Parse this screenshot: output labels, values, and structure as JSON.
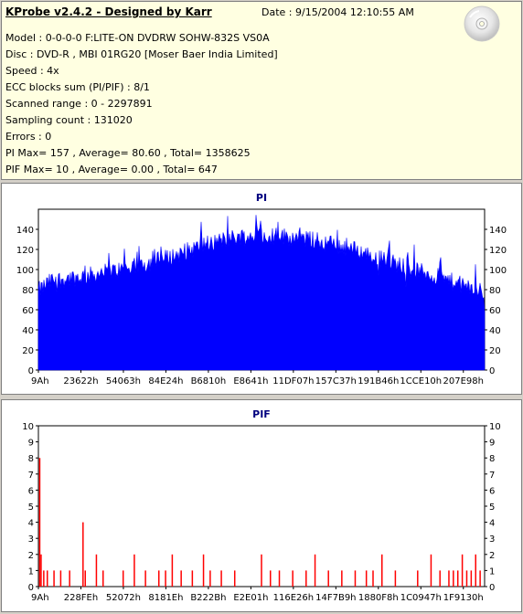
{
  "header": {
    "app_title": "KProbe v2.4.2 - Designed by Karr",
    "date": "Date : 9/15/2004 12:10:55 AM",
    "lines": [
      "Model : 0-0-0-0 F:LITE-ON DVDRW SOHW-832S  VS0A",
      "Disc : DVD-R , MBI 01RG20   [Moser Baer India Limited]",
      "Speed : 4x",
      "ECC blocks sum (PI/PIF) : 8/1",
      "Scanned range : 0 - 2297891",
      "Sampling count : 131020",
      "Errors : 0",
      "PI Max= 157 , Average= 80.60 , Total= 1358625",
      "PIF Max= 10 , Average= 0.00 , Total= 647"
    ],
    "icon": "disc-icon"
  },
  "chart_data": [
    {
      "type": "area",
      "title": "PI",
      "color": "#0000ff",
      "ylim": [
        0,
        160
      ],
      "yticks": [
        0,
        20,
        40,
        60,
        80,
        100,
        120,
        140
      ],
      "xtick_labels": [
        "9Ah",
        "23622h",
        "54063h",
        "84E24h",
        "B6810h",
        "E8641h",
        "11DF07h",
        "157C37h",
        "191B46h",
        "1CCE10h",
        "207E98h"
      ],
      "profile": {
        "x": [
          0,
          0.03,
          0.1,
          0.2,
          0.3,
          0.38,
          0.45,
          0.5,
          0.55,
          0.62,
          0.7,
          0.78,
          0.85,
          0.92,
          0.97,
          1.0
        ],
        "y": [
          78,
          88,
          92,
          100,
          112,
          125,
          132,
          133,
          132,
          128,
          120,
          108,
          98,
          88,
          80,
          76
        ]
      },
      "grid": false
    },
    {
      "type": "bar",
      "title": "PIF",
      "color": "#ff0000",
      "ylim": [
        0,
        10
      ],
      "yticks": [
        0,
        1,
        2,
        3,
        4,
        5,
        6,
        7,
        8,
        9,
        10
      ],
      "xtick_labels": [
        "9Ah",
        "228FEh",
        "52072h",
        "8181Eh",
        "B222Bh",
        "E2E01h",
        "116E26h",
        "14F7B9h",
        "1880F8h",
        "1C0947h",
        "1F9130h"
      ],
      "spikes": [
        {
          "x": 0.003,
          "y": 8
        },
        {
          "x": 0.006,
          "y": 2
        },
        {
          "x": 0.012,
          "y": 1
        },
        {
          "x": 0.02,
          "y": 1
        },
        {
          "x": 0.035,
          "y": 1
        },
        {
          "x": 0.05,
          "y": 1
        },
        {
          "x": 0.07,
          "y": 1
        },
        {
          "x": 0.1,
          "y": 4
        },
        {
          "x": 0.105,
          "y": 1
        },
        {
          "x": 0.13,
          "y": 2
        },
        {
          "x": 0.145,
          "y": 1
        },
        {
          "x": 0.19,
          "y": 1
        },
        {
          "x": 0.215,
          "y": 2
        },
        {
          "x": 0.24,
          "y": 1
        },
        {
          "x": 0.27,
          "y": 1
        },
        {
          "x": 0.285,
          "y": 1
        },
        {
          "x": 0.3,
          "y": 2
        },
        {
          "x": 0.32,
          "y": 1
        },
        {
          "x": 0.345,
          "y": 1
        },
        {
          "x": 0.37,
          "y": 2
        },
        {
          "x": 0.385,
          "y": 1
        },
        {
          "x": 0.41,
          "y": 1
        },
        {
          "x": 0.44,
          "y": 1
        },
        {
          "x": 0.5,
          "y": 2
        },
        {
          "x": 0.52,
          "y": 1
        },
        {
          "x": 0.54,
          "y": 1
        },
        {
          "x": 0.57,
          "y": 1
        },
        {
          "x": 0.6,
          "y": 1
        },
        {
          "x": 0.62,
          "y": 2
        },
        {
          "x": 0.65,
          "y": 1
        },
        {
          "x": 0.68,
          "y": 1
        },
        {
          "x": 0.71,
          "y": 1
        },
        {
          "x": 0.735,
          "y": 1
        },
        {
          "x": 0.75,
          "y": 1
        },
        {
          "x": 0.77,
          "y": 2
        },
        {
          "x": 0.8,
          "y": 1
        },
        {
          "x": 0.85,
          "y": 1
        },
        {
          "x": 0.88,
          "y": 2
        },
        {
          "x": 0.9,
          "y": 1
        },
        {
          "x": 0.92,
          "y": 1
        },
        {
          "x": 0.93,
          "y": 1
        },
        {
          "x": 0.94,
          "y": 1
        },
        {
          "x": 0.95,
          "y": 2
        },
        {
          "x": 0.96,
          "y": 1
        },
        {
          "x": 0.97,
          "y": 1
        },
        {
          "x": 0.98,
          "y": 2
        },
        {
          "x": 0.99,
          "y": 1
        }
      ],
      "grid": false
    }
  ]
}
